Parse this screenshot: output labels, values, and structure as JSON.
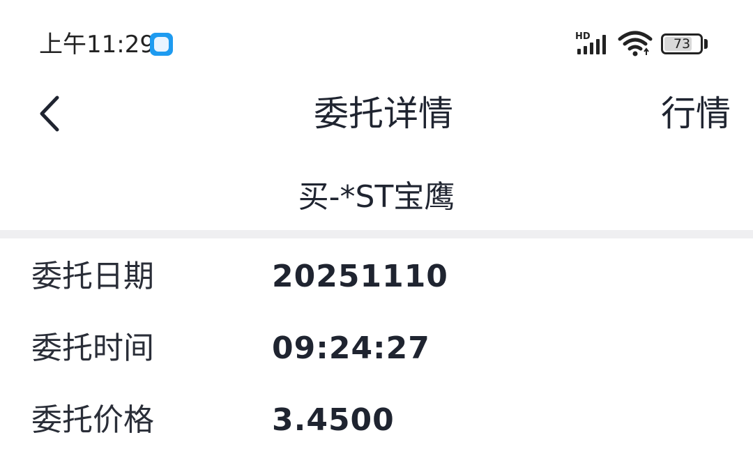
{
  "status_bar": {
    "time": "上午11:29",
    "network_label": "HD",
    "battery_level": "73"
  },
  "header": {
    "title": "委托详情",
    "right_action": "行情"
  },
  "stock": {
    "title": "买-*ST宝鹰"
  },
  "details": [
    {
      "label": "委托日期",
      "value": "20251110"
    },
    {
      "label": "委托时间",
      "value": "09:24:27"
    },
    {
      "label": "委托价格",
      "value": "3.4500"
    }
  ],
  "icons": {
    "back": "chevron-left-icon",
    "signal": "signal-icon",
    "wifi": "wifi-icon",
    "battery": "battery-icon",
    "notification": "app-notification-icon"
  }
}
